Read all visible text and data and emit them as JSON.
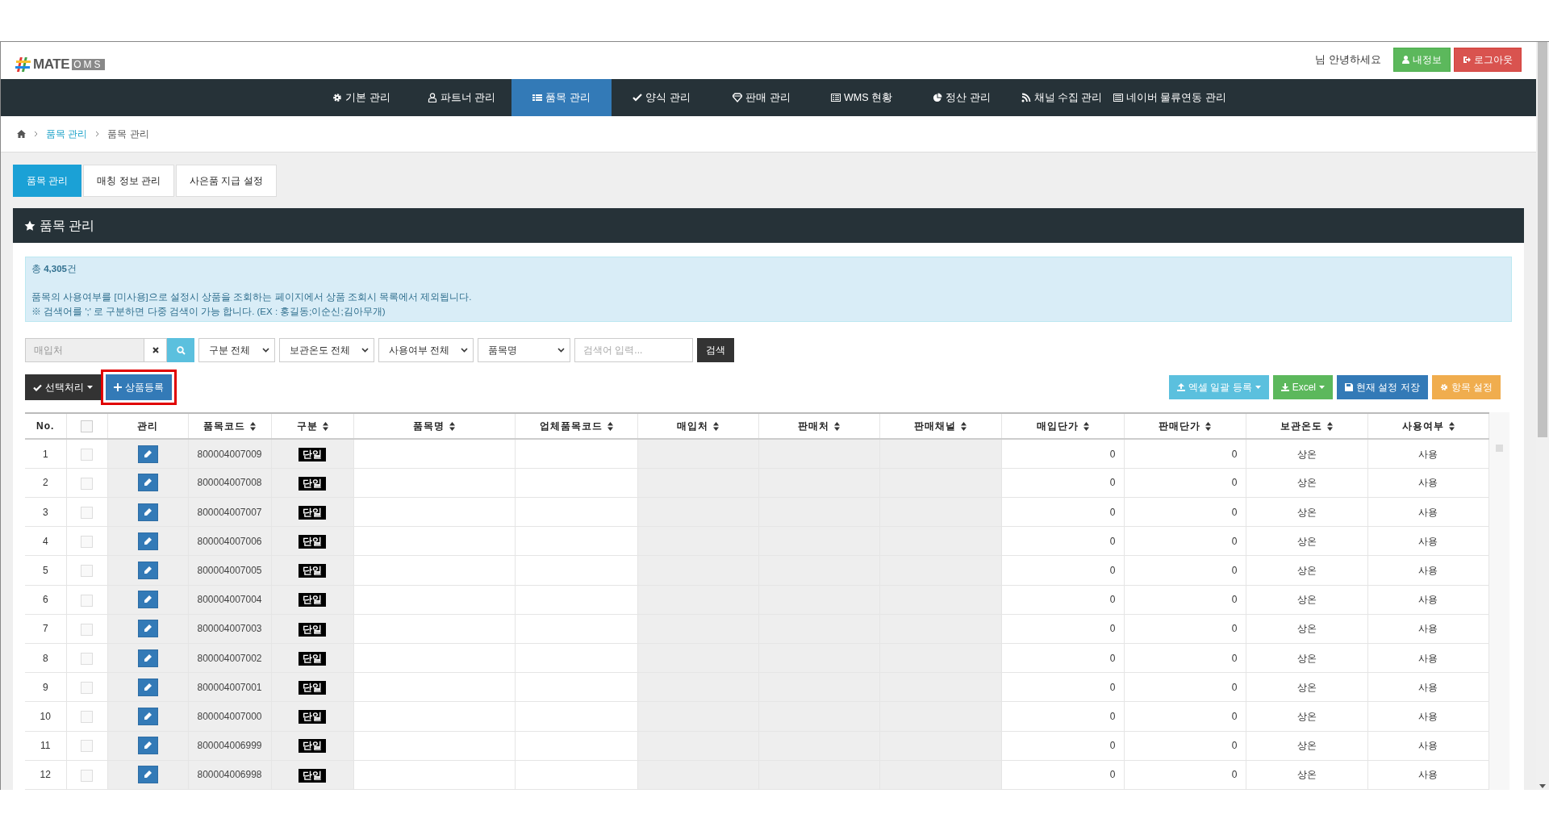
{
  "header": {
    "logo": [
      "MATE",
      "OMS"
    ],
    "greeting": "님 안녕하세요",
    "buttons": [
      {
        "label": "내정보",
        "kind": "profile"
      },
      {
        "label": "로그아웃",
        "kind": "logout"
      }
    ]
  },
  "nav": [
    {
      "label": "기본 관리",
      "selected": false
    },
    {
      "label": "파트너 관리",
      "selected": false
    },
    {
      "label": "품목 관리",
      "selected": true
    },
    {
      "label": "양식 관리",
      "selected": false
    },
    {
      "label": "판매 관리",
      "selected": false
    },
    {
      "label": "WMS 현황",
      "selected": false
    },
    {
      "label": "정산 관리",
      "selected": false
    },
    {
      "label": "채널 수집 관리",
      "selected": false
    },
    {
      "label": "네이버 물류연동 관리",
      "selected": false
    }
  ],
  "breadcrumb": [
    "품목 관리",
    "품목 관리"
  ],
  "tabs": [
    {
      "label": "품목 관리",
      "selected": true
    },
    {
      "label": "매칭 정보 관리",
      "selected": false
    },
    {
      "label": "사은품 지급 설정",
      "selected": false
    }
  ],
  "panel": {
    "title": "품목 관리",
    "info": {
      "total": "총 **4,305**건",
      "lines": [
        "품목의 사용여부를 [미사용]으로 설정시 상품을 조회하는 페이지에서 상품 조회시 목록에서 제외됩니다.",
        "※ 검색어를 ';' 로 구분하면 다중 검색이 가능 합니다. (EX : 홍길동;이순신;김아무개)"
      ]
    },
    "filters": {
      "supplier_placeholder": "매입처",
      "selects": [
        "구분 전체",
        "보관온도 전체",
        "사용여부 전체",
        "품목명"
      ],
      "search_placeholder": "검색어 입력...",
      "search_button": "검색"
    },
    "toolbar_left": [
      {
        "label": "선택처리",
        "kind": "dropdown",
        "highlighted": false
      },
      {
        "label": "상품등록",
        "kind": "add",
        "highlighted": true
      }
    ],
    "toolbar_right": [
      {
        "label": "엑셀 일괄 등록",
        "kind": "upload"
      },
      {
        "label": "Excel",
        "kind": "download"
      },
      {
        "label": "현재 설정 저장",
        "kind": "save"
      },
      {
        "label": "항목 설정",
        "kind": "settings"
      }
    ],
    "table": {
      "select_all_checked": false,
      "columns": [
        {
          "label": "No.",
          "sortable": false
        },
        {
          "label": "관리",
          "sortable": false
        },
        {
          "label": "품목코드",
          "sortable": true
        },
        {
          "label": "구분",
          "sortable": true
        },
        {
          "label": "품목명",
          "sortable": true
        },
        {
          "label": "업체품목코드",
          "sortable": true
        },
        {
          "label": "매입처",
          "sortable": true
        },
        {
          "label": "판매처",
          "sortable": true
        },
        {
          "label": "판매채널",
          "sortable": true
        },
        {
          "label": "매입단가",
          "sortable": true
        },
        {
          "label": "판매단가",
          "sortable": true
        },
        {
          "label": "보관온도",
          "sortable": true
        },
        {
          "label": "사용여부",
          "sortable": true
        }
      ],
      "rows": [
        {
          "no": "1",
          "checked": false,
          "code": "800004007009",
          "type": "단일",
          "buy_price": "0",
          "sell_price": "0",
          "storage": "상온",
          "use": "사용"
        },
        {
          "no": "2",
          "checked": false,
          "code": "800004007008",
          "type": "단일",
          "buy_price": "0",
          "sell_price": "0",
          "storage": "상온",
          "use": "사용"
        },
        {
          "no": "3",
          "checked": false,
          "code": "800004007007",
          "type": "단일",
          "buy_price": "0",
          "sell_price": "0",
          "storage": "상온",
          "use": "사용"
        },
        {
          "no": "4",
          "checked": false,
          "code": "800004007006",
          "type": "단일",
          "buy_price": "0",
          "sell_price": "0",
          "storage": "상온",
          "use": "사용"
        },
        {
          "no": "5",
          "checked": false,
          "code": "800004007005",
          "type": "단일",
          "buy_price": "0",
          "sell_price": "0",
          "storage": "상온",
          "use": "사용"
        },
        {
          "no": "6",
          "checked": false,
          "code": "800004007004",
          "type": "단일",
          "buy_price": "0",
          "sell_price": "0",
          "storage": "상온",
          "use": "사용"
        },
        {
          "no": "7",
          "checked": false,
          "code": "800004007003",
          "type": "단일",
          "buy_price": "0",
          "sell_price": "0",
          "storage": "상온",
          "use": "사용"
        },
        {
          "no": "8",
          "checked": false,
          "code": "800004007002",
          "type": "단일",
          "buy_price": "0",
          "sell_price": "0",
          "storage": "상온",
          "use": "사용"
        },
        {
          "no": "9",
          "checked": false,
          "code": "800004007001",
          "type": "단일",
          "buy_price": "0",
          "sell_price": "0",
          "storage": "상온",
          "use": "사용"
        },
        {
          "no": "10",
          "checked": false,
          "code": "800004007000",
          "type": "단일",
          "buy_price": "0",
          "sell_price": "0",
          "storage": "상온",
          "use": "사용"
        },
        {
          "no": "11",
          "checked": false,
          "code": "800004006999",
          "type": "단일",
          "buy_price": "0",
          "sell_price": "0",
          "storage": "상온",
          "use": "사용"
        },
        {
          "no": "12",
          "checked": false,
          "code": "800004006998",
          "type": "단일",
          "buy_price": "0",
          "sell_price": "0",
          "storage": "상온",
          "use": "사용"
        }
      ]
    }
  }
}
